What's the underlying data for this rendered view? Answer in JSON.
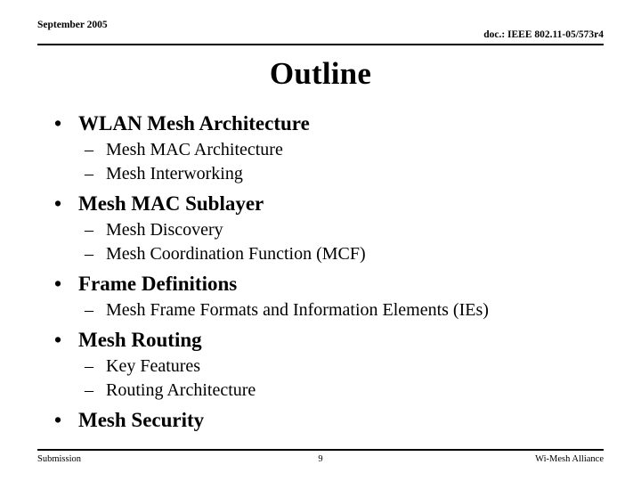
{
  "slide": {
    "header": {
      "date": "September 2005",
      "doc": "doc.: IEEE 802.11-05/573r4"
    },
    "title": "Outline",
    "sections": [
      {
        "heading": "WLAN Mesh Architecture",
        "items": [
          "Mesh MAC Architecture",
          "Mesh Interworking"
        ]
      },
      {
        "heading": "Mesh MAC Sublayer",
        "items": [
          "Mesh Discovery",
          "Mesh Coordination Function (MCF)"
        ]
      },
      {
        "heading": "Frame Definitions",
        "items": [
          "Mesh Frame Formats and Information Elements (IEs)"
        ]
      },
      {
        "heading": "Mesh Routing",
        "items": [
          "Key Features",
          "Routing Architecture"
        ]
      },
      {
        "heading": "Mesh Security",
        "items": []
      }
    ],
    "markers": {
      "level1": "•",
      "level2": "–"
    },
    "footer": {
      "left": "Submission",
      "page": "9",
      "right": "Wi-Mesh Alliance"
    },
    "colors": {
      "text": "#000000",
      "background": "#ffffff",
      "rule": "#000000"
    }
  }
}
